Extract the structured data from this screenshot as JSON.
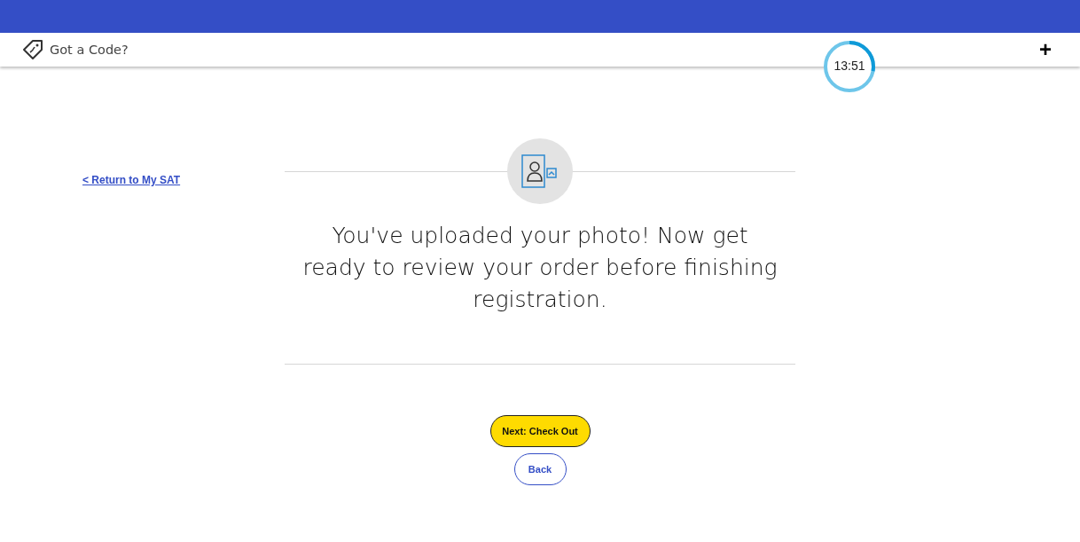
{
  "header": {
    "code_label": "Got a Code?",
    "timer": {
      "text": "13:51",
      "level": 0.28
    },
    "expand": "+"
  },
  "return_link": "< Return to My SAT",
  "message": "You've uploaded your photo! Now get ready to review your order before finishing registration.",
  "buttons": [
    {
      "kind": "primary",
      "label": "Next: Check Out"
    },
    {
      "kind": "secondary",
      "label": "Back"
    }
  ]
}
